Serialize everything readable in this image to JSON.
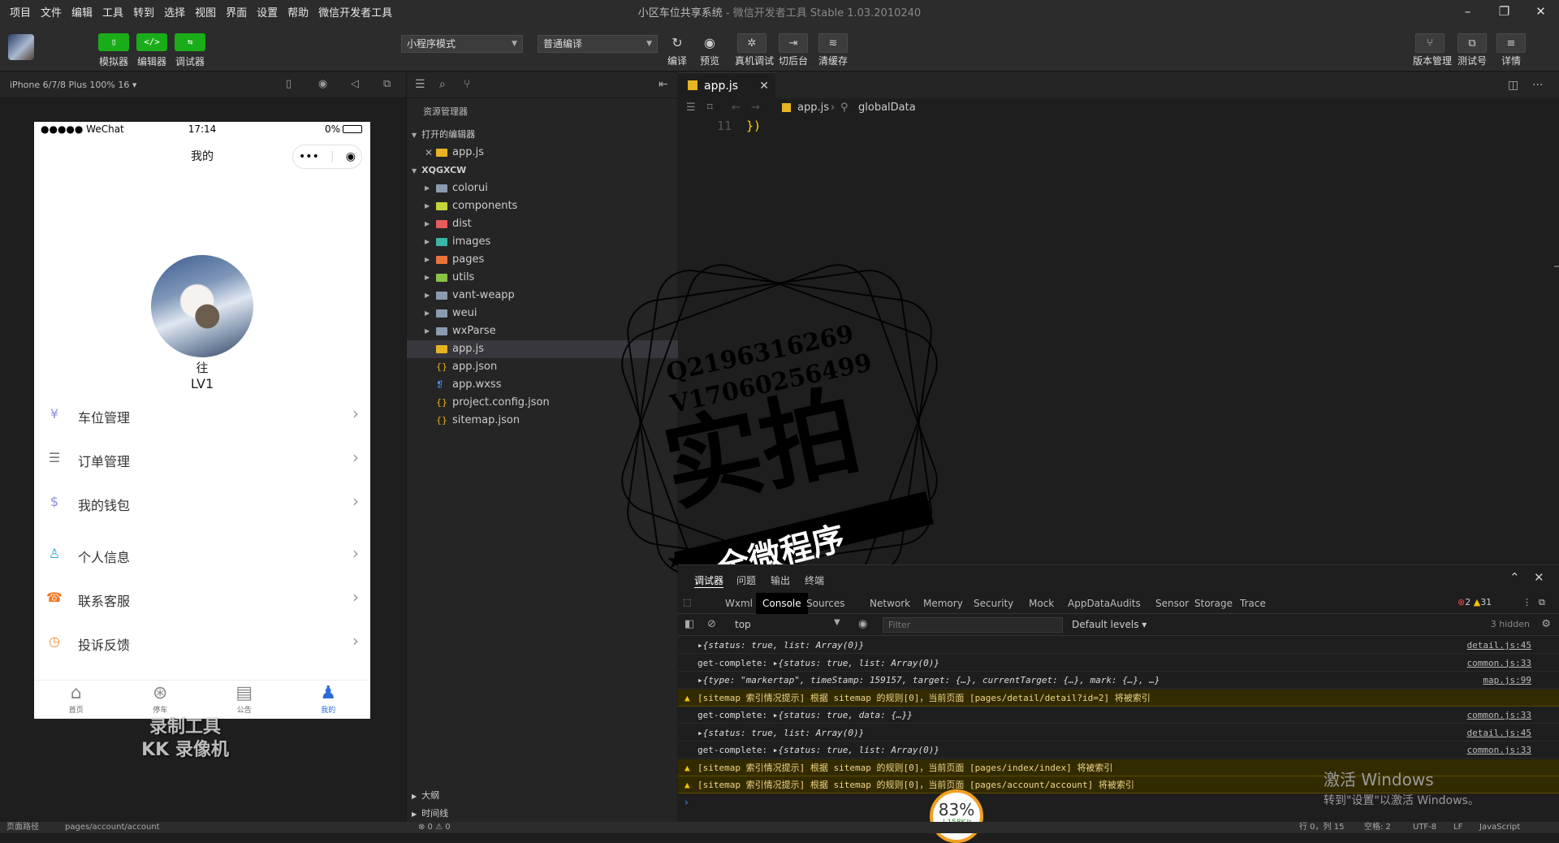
{
  "menu": [
    "项目",
    "文件",
    "编辑",
    "工具",
    "转到",
    "选择",
    "视图",
    "界面",
    "设置",
    "帮助",
    "微信开发者工具"
  ],
  "window": {
    "title": "小区车位共享系统",
    "subtitle": " - 微信开发者工具 Stable 1.03.2010240"
  },
  "toolbar": {
    "left_buttons": [
      {
        "label": "模拟器",
        "glyph": "▯"
      },
      {
        "label": "编辑器",
        "glyph": "</>"
      },
      {
        "label": "调试器",
        "glyph": "⇆"
      }
    ],
    "mode_select": "小程序模式",
    "compile_select": "普通编译",
    "actions": [
      {
        "label": "编译",
        "icon": "refresh-icon",
        "glyph": "↻"
      },
      {
        "label": "预览",
        "icon": "eye-icon",
        "glyph": "◉"
      },
      {
        "label": "真机调试",
        "icon": "bug-icon",
        "glyph": "✲"
      },
      {
        "label": "切后台",
        "icon": "switch-icon",
        "glyph": "⇥"
      },
      {
        "label": "清缓存",
        "icon": "layers-icon",
        "glyph": "≋"
      }
    ],
    "right_actions": [
      {
        "label": "版本管理",
        "icon": "branch-icon",
        "glyph": "⑂"
      },
      {
        "label": "测试号",
        "icon": "external-icon",
        "glyph": "⧉"
      },
      {
        "label": "详情",
        "icon": "menu-icon",
        "glyph": "≡"
      }
    ]
  },
  "simulator": {
    "device": "iPhone 6/7/8 Plus 100% 16 ▾",
    "status": {
      "carrier": "●●●●● WeChat",
      "time": "17:14",
      "battery": "0%"
    },
    "nav_title": "我的",
    "user": {
      "name": "往",
      "level": "LV1"
    },
    "menu_items": [
      {
        "label": "车位管理",
        "icon": "parking-icon",
        "glyph": "¥",
        "color": "#8e8ee0"
      },
      {
        "label": "订单管理",
        "icon": "list-icon",
        "glyph": "☰",
        "color": "#777777"
      },
      {
        "label": "我的钱包",
        "icon": "wallet-icon",
        "glyph": "$",
        "color": "#8e8ee0"
      },
      {
        "label": "个人信息",
        "icon": "user-icon",
        "glyph": "♙",
        "color": "#29a3e8"
      },
      {
        "label": "联系客服",
        "icon": "headset-icon",
        "glyph": "☎",
        "color": "#f07820"
      },
      {
        "label": "投诉反馈",
        "icon": "clock-icon",
        "glyph": "◷",
        "color": "#f08a28"
      }
    ],
    "tabs": [
      {
        "label": "首页",
        "glyph": "⌂"
      },
      {
        "label": "停车",
        "glyph": "⊛"
      },
      {
        "label": "公告",
        "glyph": "▤"
      },
      {
        "label": "我的",
        "glyph": "♟"
      }
    ],
    "watermark": [
      "录制工具",
      "KK 录像机"
    ]
  },
  "explorer": {
    "title": "资源管理器",
    "open_editors": "打开的编辑器",
    "open_files": [
      "app.js"
    ],
    "project": "XQGXCW",
    "items": [
      {
        "name": "colorui",
        "type": "folder",
        "color": "#8a9bb0"
      },
      {
        "name": "components",
        "type": "folder",
        "color": "#c5d23a"
      },
      {
        "name": "dist",
        "type": "folder",
        "color": "#e85b5b"
      },
      {
        "name": "images",
        "type": "folder",
        "color": "#3ab5a8"
      },
      {
        "name": "pages",
        "type": "folder",
        "color": "#e8733a"
      },
      {
        "name": "utils",
        "type": "folder",
        "color": "#8ac24a"
      },
      {
        "name": "vant-weapp",
        "type": "folder",
        "color": "#8a9bb0"
      },
      {
        "name": "weui",
        "type": "folder",
        "color": "#8a9bb0"
      },
      {
        "name": "wxParse",
        "type": "folder",
        "color": "#8a9bb0"
      },
      {
        "name": "app.js",
        "type": "js",
        "color": "#e6b422"
      },
      {
        "name": "app.json",
        "type": "json",
        "color": "#e6b422"
      },
      {
        "name": "app.wxss",
        "type": "wxss",
        "color": "#3a8ee8"
      },
      {
        "name": "project.config.json",
        "type": "json",
        "color": "#e6b422"
      },
      {
        "name": "sitemap.json",
        "type": "json",
        "color": "#e6b422"
      }
    ],
    "outline": "大纲",
    "timeline": "时间线"
  },
  "editor": {
    "tab": "app.js",
    "breadcrumb": {
      "file": "app.js",
      "symbol": "globalData"
    },
    "line_number": "11",
    "code": "})"
  },
  "stamp": {
    "qq": "Q2196316269",
    "vx": "V17060256499",
    "main": "实拍",
    "banner": "全微程序"
  },
  "debugger": {
    "panel_tabs": [
      "调试器",
      "问题",
      "输出",
      "终端"
    ],
    "devtools_tabs": [
      "Wxml",
      "Console",
      "Sources",
      "Network",
      "Memory",
      "Security",
      "Mock",
      "AppData",
      "Audits",
      "Sensor",
      "Storage",
      "Trace"
    ],
    "errors": "2",
    "warnings": "31",
    "context": "top",
    "filter_placeholder": "Filter",
    "levels": "Default levels ▾",
    "hidden": "3 hidden",
    "logs": [
      {
        "type": "log",
        "prefix": "",
        "text": "▸{status: true, list: Array(0)}",
        "source": "detail.js:45"
      },
      {
        "type": "log",
        "prefix": "get-complete: ",
        "text": "▸{status: true, list: Array(0)}",
        "source": "common.js:33"
      },
      {
        "type": "log",
        "prefix": "",
        "text": "▸{type: \"markertap\", timeStamp: 159157, target: {…}, currentTarget: {…}, mark: {…}, …}",
        "source": "map.js:99"
      },
      {
        "type": "warn",
        "prefix": "",
        "text": "[sitemap 索引情况提示] 根据 sitemap 的规则[0]，当前页面 [pages/detail/detail?id=2] 将被索引",
        "source": ""
      },
      {
        "type": "log",
        "prefix": "get-complete: ",
        "text": "▸{status: true, data: {…}}",
        "source": "common.js:33"
      },
      {
        "type": "log",
        "prefix": "",
        "text": "▸{status: true, list: Array(0)}",
        "source": "detail.js:45"
      },
      {
        "type": "log",
        "prefix": "get-complete: ",
        "text": "▸{status: true, list: Array(0)}",
        "source": "common.js:33"
      },
      {
        "type": "warn",
        "prefix": "",
        "text": "[sitemap 索引情况提示] 根据 sitemap 的规则[0]，当前页面 [pages/index/index] 将被索引",
        "source": ""
      },
      {
        "type": "warn",
        "prefix": "",
        "text": "[sitemap 索引情况提示] 根据 sitemap 的规则[0]，当前页面 [pages/account/account] 将被索引",
        "source": ""
      }
    ]
  },
  "overlay": {
    "activate_title": "激活 Windows",
    "activate_sub": "转到\"设置\"以激活 Windows。",
    "speed_percent": "83%",
    "speed_rate": "↓158K/s"
  },
  "statusbar": {
    "path": "页面路径",
    "page": "pages/account/account",
    "problems": "⊗ 0 ⚠ 0",
    "pos": "行 0，列 15",
    "spaces": "空格: 2",
    "enc": "UTF-8",
    "eol": "LF",
    "lang": "JavaScript"
  }
}
